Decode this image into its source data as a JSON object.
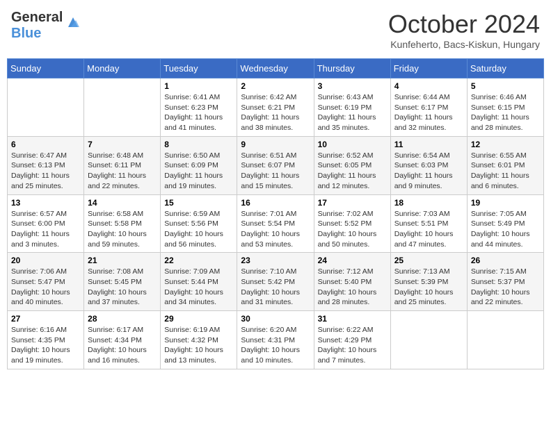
{
  "header": {
    "logo_general": "General",
    "logo_blue": "Blue",
    "month_title": "October 2024",
    "subtitle": "Kunfeherto, Bacs-Kiskun, Hungary"
  },
  "weekdays": [
    "Sunday",
    "Monday",
    "Tuesday",
    "Wednesday",
    "Thursday",
    "Friday",
    "Saturday"
  ],
  "weeks": [
    [
      {
        "day": "",
        "sunrise": "",
        "sunset": "",
        "daylight": ""
      },
      {
        "day": "",
        "sunrise": "",
        "sunset": "",
        "daylight": ""
      },
      {
        "day": "1",
        "sunrise": "Sunrise: 6:41 AM",
        "sunset": "Sunset: 6:23 PM",
        "daylight": "Daylight: 11 hours and 41 minutes."
      },
      {
        "day": "2",
        "sunrise": "Sunrise: 6:42 AM",
        "sunset": "Sunset: 6:21 PM",
        "daylight": "Daylight: 11 hours and 38 minutes."
      },
      {
        "day": "3",
        "sunrise": "Sunrise: 6:43 AM",
        "sunset": "Sunset: 6:19 PM",
        "daylight": "Daylight: 11 hours and 35 minutes."
      },
      {
        "day": "4",
        "sunrise": "Sunrise: 6:44 AM",
        "sunset": "Sunset: 6:17 PM",
        "daylight": "Daylight: 11 hours and 32 minutes."
      },
      {
        "day": "5",
        "sunrise": "Sunrise: 6:46 AM",
        "sunset": "Sunset: 6:15 PM",
        "daylight": "Daylight: 11 hours and 28 minutes."
      }
    ],
    [
      {
        "day": "6",
        "sunrise": "Sunrise: 6:47 AM",
        "sunset": "Sunset: 6:13 PM",
        "daylight": "Daylight: 11 hours and 25 minutes."
      },
      {
        "day": "7",
        "sunrise": "Sunrise: 6:48 AM",
        "sunset": "Sunset: 6:11 PM",
        "daylight": "Daylight: 11 hours and 22 minutes."
      },
      {
        "day": "8",
        "sunrise": "Sunrise: 6:50 AM",
        "sunset": "Sunset: 6:09 PM",
        "daylight": "Daylight: 11 hours and 19 minutes."
      },
      {
        "day": "9",
        "sunrise": "Sunrise: 6:51 AM",
        "sunset": "Sunset: 6:07 PM",
        "daylight": "Daylight: 11 hours and 15 minutes."
      },
      {
        "day": "10",
        "sunrise": "Sunrise: 6:52 AM",
        "sunset": "Sunset: 6:05 PM",
        "daylight": "Daylight: 11 hours and 12 minutes."
      },
      {
        "day": "11",
        "sunrise": "Sunrise: 6:54 AM",
        "sunset": "Sunset: 6:03 PM",
        "daylight": "Daylight: 11 hours and 9 minutes."
      },
      {
        "day": "12",
        "sunrise": "Sunrise: 6:55 AM",
        "sunset": "Sunset: 6:01 PM",
        "daylight": "Daylight: 11 hours and 6 minutes."
      }
    ],
    [
      {
        "day": "13",
        "sunrise": "Sunrise: 6:57 AM",
        "sunset": "Sunset: 6:00 PM",
        "daylight": "Daylight: 11 hours and 3 minutes."
      },
      {
        "day": "14",
        "sunrise": "Sunrise: 6:58 AM",
        "sunset": "Sunset: 5:58 PM",
        "daylight": "Daylight: 10 hours and 59 minutes."
      },
      {
        "day": "15",
        "sunrise": "Sunrise: 6:59 AM",
        "sunset": "Sunset: 5:56 PM",
        "daylight": "Daylight: 10 hours and 56 minutes."
      },
      {
        "day": "16",
        "sunrise": "Sunrise: 7:01 AM",
        "sunset": "Sunset: 5:54 PM",
        "daylight": "Daylight: 10 hours and 53 minutes."
      },
      {
        "day": "17",
        "sunrise": "Sunrise: 7:02 AM",
        "sunset": "Sunset: 5:52 PM",
        "daylight": "Daylight: 10 hours and 50 minutes."
      },
      {
        "day": "18",
        "sunrise": "Sunrise: 7:03 AM",
        "sunset": "Sunset: 5:51 PM",
        "daylight": "Daylight: 10 hours and 47 minutes."
      },
      {
        "day": "19",
        "sunrise": "Sunrise: 7:05 AM",
        "sunset": "Sunset: 5:49 PM",
        "daylight": "Daylight: 10 hours and 44 minutes."
      }
    ],
    [
      {
        "day": "20",
        "sunrise": "Sunrise: 7:06 AM",
        "sunset": "Sunset: 5:47 PM",
        "daylight": "Daylight: 10 hours and 40 minutes."
      },
      {
        "day": "21",
        "sunrise": "Sunrise: 7:08 AM",
        "sunset": "Sunset: 5:45 PM",
        "daylight": "Daylight: 10 hours and 37 minutes."
      },
      {
        "day": "22",
        "sunrise": "Sunrise: 7:09 AM",
        "sunset": "Sunset: 5:44 PM",
        "daylight": "Daylight: 10 hours and 34 minutes."
      },
      {
        "day": "23",
        "sunrise": "Sunrise: 7:10 AM",
        "sunset": "Sunset: 5:42 PM",
        "daylight": "Daylight: 10 hours and 31 minutes."
      },
      {
        "day": "24",
        "sunrise": "Sunrise: 7:12 AM",
        "sunset": "Sunset: 5:40 PM",
        "daylight": "Daylight: 10 hours and 28 minutes."
      },
      {
        "day": "25",
        "sunrise": "Sunrise: 7:13 AM",
        "sunset": "Sunset: 5:39 PM",
        "daylight": "Daylight: 10 hours and 25 minutes."
      },
      {
        "day": "26",
        "sunrise": "Sunrise: 7:15 AM",
        "sunset": "Sunset: 5:37 PM",
        "daylight": "Daylight: 10 hours and 22 minutes."
      }
    ],
    [
      {
        "day": "27",
        "sunrise": "Sunrise: 6:16 AM",
        "sunset": "Sunset: 4:35 PM",
        "daylight": "Daylight: 10 hours and 19 minutes."
      },
      {
        "day": "28",
        "sunrise": "Sunrise: 6:17 AM",
        "sunset": "Sunset: 4:34 PM",
        "daylight": "Daylight: 10 hours and 16 minutes."
      },
      {
        "day": "29",
        "sunrise": "Sunrise: 6:19 AM",
        "sunset": "Sunset: 4:32 PM",
        "daylight": "Daylight: 10 hours and 13 minutes."
      },
      {
        "day": "30",
        "sunrise": "Sunrise: 6:20 AM",
        "sunset": "Sunset: 4:31 PM",
        "daylight": "Daylight: 10 hours and 10 minutes."
      },
      {
        "day": "31",
        "sunrise": "Sunrise: 6:22 AM",
        "sunset": "Sunset: 4:29 PM",
        "daylight": "Daylight: 10 hours and 7 minutes."
      },
      {
        "day": "",
        "sunrise": "",
        "sunset": "",
        "daylight": ""
      },
      {
        "day": "",
        "sunrise": "",
        "sunset": "",
        "daylight": ""
      }
    ]
  ]
}
